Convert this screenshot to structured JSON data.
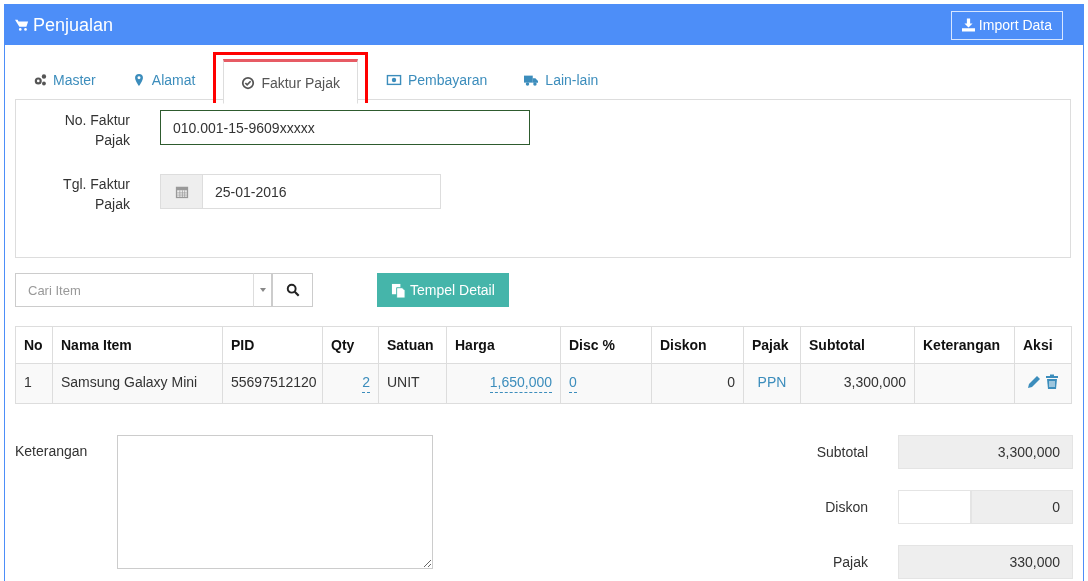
{
  "header": {
    "title": "Penjualan",
    "import_button": "Import Data"
  },
  "tabs": [
    {
      "label": "Master",
      "selected": false
    },
    {
      "label": "Alamat",
      "selected": false
    },
    {
      "label": "Faktur Pajak",
      "selected": true,
      "highlighted": true
    },
    {
      "label": "Pembayaran",
      "selected": false
    },
    {
      "label": "Lain-lain",
      "selected": false
    }
  ],
  "faktur": {
    "number_label": "No. Faktur Pajak",
    "number_value": "010.001-15-9609xxxxx",
    "date_label": "Tgl. Faktur Pajak",
    "date_value": "25-01-2016"
  },
  "search": {
    "placeholder": "Cari Item"
  },
  "paste_button": "Tempel Detail",
  "table": {
    "columns": [
      "No",
      "Nama Item",
      "PID",
      "Qty",
      "Satuan",
      "Harga",
      "Disc %",
      "Diskon",
      "Pajak",
      "Subtotal",
      "Keterangan",
      "Aksi"
    ],
    "rows": [
      {
        "cells": [
          {
            "kind": "text",
            "text": "1"
          },
          {
            "kind": "text",
            "text": "Samsung Galaxy Mini"
          },
          {
            "kind": "text",
            "text": "55697512120"
          },
          {
            "kind": "editable",
            "text": "2"
          },
          {
            "kind": "text",
            "text": "UNIT"
          },
          {
            "kind": "editable",
            "text": "1,650,000"
          },
          {
            "kind": "editable",
            "text": "0"
          },
          {
            "kind": "number",
            "text": "0"
          },
          {
            "kind": "link",
            "text": "PPN"
          },
          {
            "kind": "number",
            "text": "3,300,000"
          },
          {
            "kind": "empty"
          },
          {
            "kind": "actions"
          }
        ]
      }
    ]
  },
  "notes": {
    "label": "Keterangan"
  },
  "totals": [
    {
      "kind": "plain",
      "label": "Subtotal",
      "value": "3,300,000"
    },
    {
      "kind": "split",
      "label": "Diskon",
      "value": "0"
    },
    {
      "kind": "plain",
      "label": "Pajak",
      "value": "330,000"
    }
  ]
}
